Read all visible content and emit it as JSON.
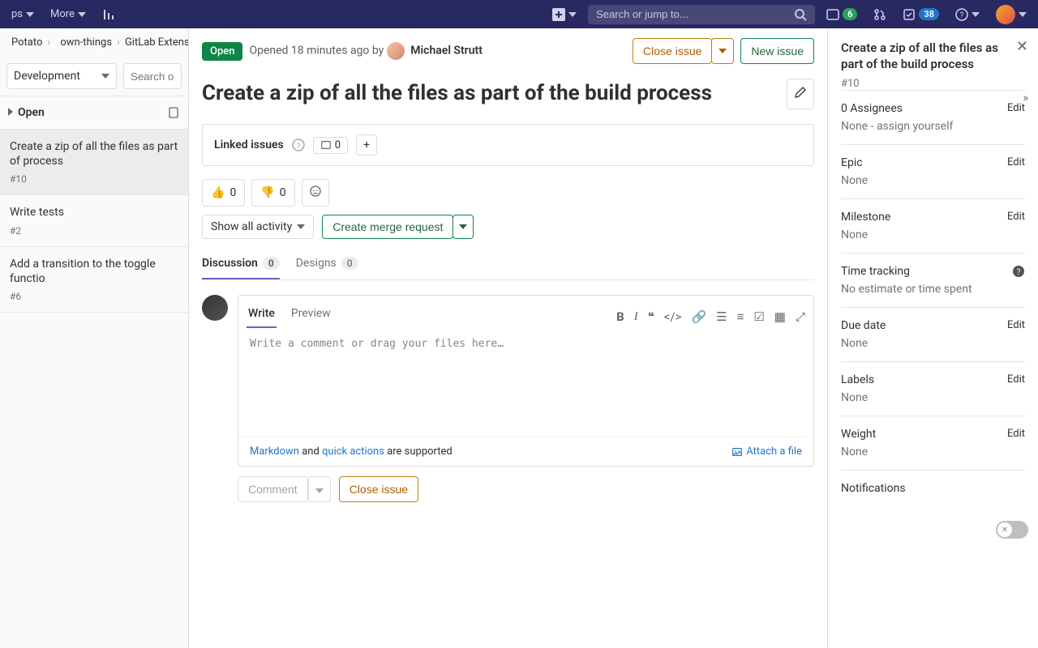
{
  "topbar": {
    "tabs": [
      "ps",
      "More"
    ],
    "search_placeholder": "Search or jump to...",
    "todos_count": "6",
    "merge_badge": "38"
  },
  "breadcrumbs": [
    "Potato",
    "own-things",
    "GitLab Extensio"
  ],
  "sideSelect": "Development",
  "side_search_placeholder": "Search or filt",
  "side_section": "Open",
  "issues": [
    {
      "title": "Create a zip of all the files as part of process",
      "num": "#10"
    },
    {
      "title": "Write tests",
      "num": "#2"
    },
    {
      "title": "Add a transition to the toggle functio",
      "num": "#6"
    }
  ],
  "header": {
    "status": "Open",
    "meta_opened": "Opened 18 minutes ago by",
    "author": "Michael Strutt",
    "close_btn": "Close issue",
    "new_btn": "New issue"
  },
  "issue_title": "Create a zip of all the files as part of the build process",
  "linked": {
    "label": "Linked issues",
    "count": "0"
  },
  "reactions": {
    "up": "0",
    "down": "0"
  },
  "activity_dropdown": "Show all activity",
  "create_mr": "Create merge request",
  "tabs": {
    "discussion": "Discussion",
    "discussion_count": "0",
    "designs": "Designs",
    "designs_count": "0"
  },
  "editor": {
    "write": "Write",
    "preview": "Preview",
    "placeholder": "Write a comment or drag your files here…",
    "md_link": "Markdown",
    "and": " and ",
    "qa_link": "quick actions",
    "supported": " are supported",
    "attach": "Attach a file"
  },
  "post": {
    "comment_btn": "Comment",
    "close_btn": "Close issue"
  },
  "right": {
    "title": "Create a zip of all the files as part of the build process",
    "id": "#10",
    "assignees_label": "0 Assignees",
    "assignees_val": "None - assign yourself",
    "epic_label": "Epic",
    "epic_val": "None",
    "milestone_label": "Milestone",
    "milestone_val": "None",
    "time_label": "Time tracking",
    "time_val": "No estimate or time spent",
    "due_label": "Due date",
    "due_val": "None",
    "labels_label": "Labels",
    "labels_val": "None",
    "weight_label": "Weight",
    "weight_val": "None",
    "notif_label": "Notifications",
    "edit": "Edit"
  }
}
